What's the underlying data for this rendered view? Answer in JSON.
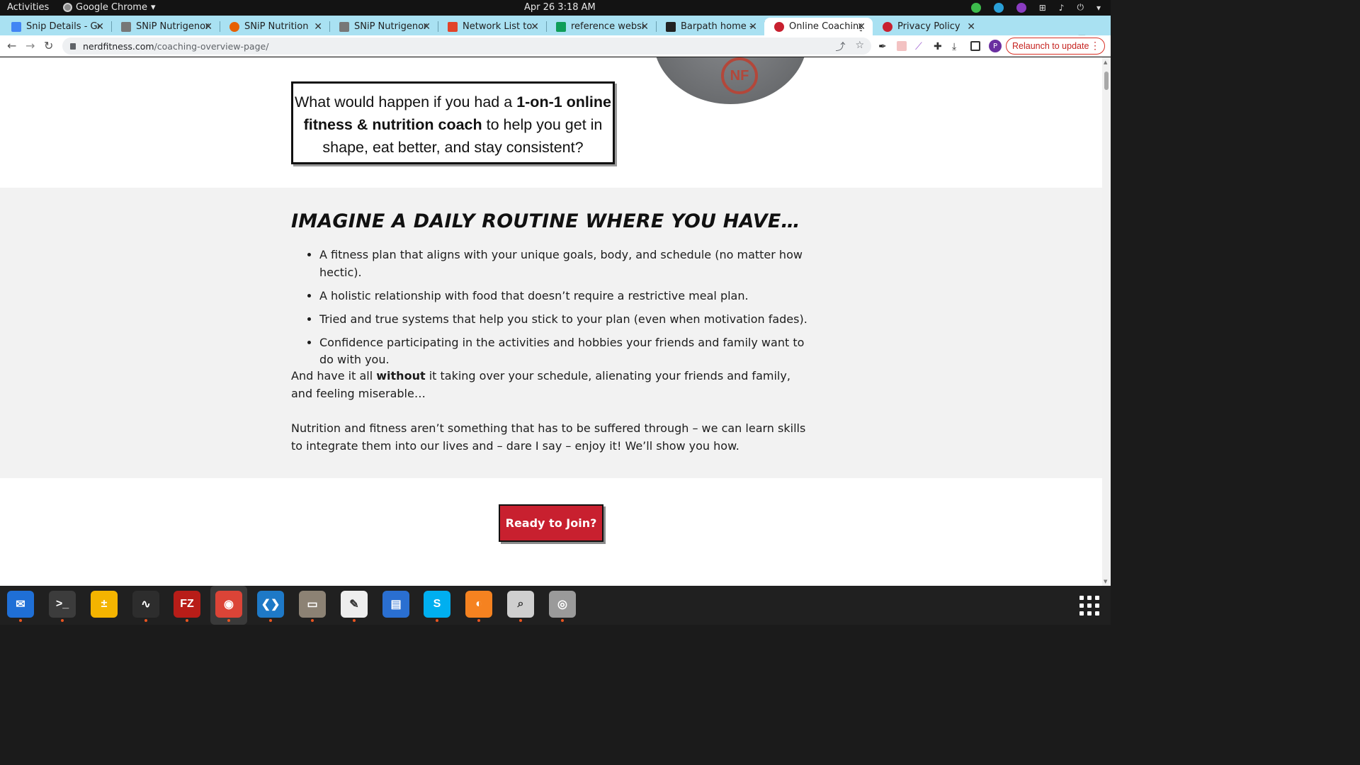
{
  "topbar": {
    "activities": "Activities",
    "app_name": "Google Chrome",
    "clock": "Apr 26  3:18 AM"
  },
  "tabs": [
    {
      "title": "Snip Details - Goo",
      "favicon": "google-docs-icon",
      "color": "#4285f4"
    },
    {
      "title": "SNiP Nutrigenomi",
      "favicon": "snip-icon",
      "color": "#555555"
    },
    {
      "title": "SNiP Nutrition",
      "favicon": "firefox-like-icon",
      "color": "#e66000"
    },
    {
      "title": "SNiP Nutrigenomi",
      "favicon": "snip-icon",
      "color": "#555555"
    },
    {
      "title": "Network List to Ac",
      "favicon": "gitlab-icon",
      "color": "#e24329"
    },
    {
      "title": "reference website",
      "favicon": "google-sheets-icon",
      "color": "#0f9d58"
    },
    {
      "title": "Barpath home - Ba",
      "favicon": "rpa-icon",
      "color": "#222222"
    },
    {
      "title": "Online Coaching: ",
      "favicon": "nerdfitness-icon",
      "color": "#c8202f",
      "active": true
    },
    {
      "title": "Privacy Policy",
      "favicon": "nerdfitness-icon",
      "color": "#c8202f"
    }
  ],
  "toolbar": {
    "url_host": "nerdfitness.com",
    "url_path": "/coaching-overview-page/",
    "profile_initial": "P",
    "relaunch_label": "Relaunch to update"
  },
  "page": {
    "question_pre": "What would happen if you had a ",
    "question_bold": "1-on-1 online fitness & nutrition coach",
    "question_post": " to help you get in shape, eat better, and stay consistent?",
    "routine_heading": "IMAGINE A DAILY ROUTINE WHERE YOU HAVE…",
    "routine_items": [
      "A fitness plan that aligns with your unique goals, body, and schedule (no matter how hectic).",
      "A holistic relationship with food that doesn’t require a restrictive meal plan.",
      "Tried and true systems that help you stick to your plan (even when motivation fades).",
      "Confidence participating in the activities and hobbies your friends and family want to do with you."
    ],
    "para1_pre": "And have it all ",
    "para1_bold": "without",
    "para1_post": " it taking over your schedule, alienating your friends and family, and feeling miserable…",
    "para2": "Nutrition and fitness aren’t something that has to be suffered through – we can learn skills to integrate them into our lives and – dare I say – enjoy it! We’ll show you how.",
    "cta_label": "Ready to Join?",
    "logo_text": "NF"
  },
  "dock": [
    {
      "name": "thunderbird-icon",
      "color": "#1f6fd6",
      "glyph": "✉"
    },
    {
      "name": "terminal-icon",
      "color": "#3c3c3c",
      "glyph": ">_"
    },
    {
      "name": "calculator-icon",
      "color": "#f4b400",
      "glyph": "±"
    },
    {
      "name": "system-monitor-icon",
      "color": "#2d2d2d",
      "glyph": "∿"
    },
    {
      "name": "filezilla-icon",
      "color": "#b81d18",
      "glyph": "FZ"
    },
    {
      "name": "chrome-icon",
      "color": "#db4437",
      "glyph": "◉"
    },
    {
      "name": "vscode-icon",
      "color": "#1e79c7",
      "glyph": "❮❯"
    },
    {
      "name": "files-icon",
      "color": "#8c8274",
      "glyph": "▭"
    },
    {
      "name": "text-editor-icon",
      "color": "#eeeeee",
      "glyph": "✎"
    },
    {
      "name": "document-viewer-icon",
      "color": "#2a6fd1",
      "glyph": "▤"
    },
    {
      "name": "skype-icon",
      "color": "#00aff0",
      "glyph": "S"
    },
    {
      "name": "burner-icon",
      "color": "#f58220",
      "glyph": "◐"
    },
    {
      "name": "image-viewer-icon",
      "color": "#cfcfcf",
      "glyph": "⌕"
    },
    {
      "name": "disk-icon",
      "color": "#9a9a9a",
      "glyph": "◎"
    }
  ]
}
